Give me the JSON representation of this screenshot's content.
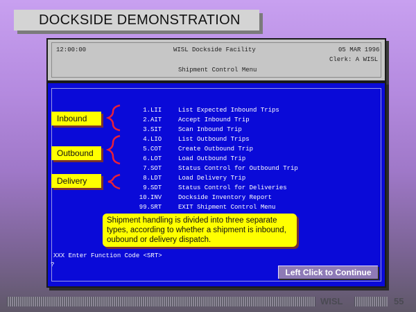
{
  "title": "DOCKSIDE DEMONSTRATION",
  "header": {
    "time": "12:00:00",
    "facility": "WISL Dockside Facility",
    "date": "05 MAR 1996",
    "clerk": "Clerk: A WISL",
    "menu_title": "Shipment Control Menu"
  },
  "menu": [
    {
      "num": "1.",
      "code": "LII",
      "desc": "List Expected Inbound Trips"
    },
    {
      "num": "2.",
      "code": "AIT",
      "desc": "Accept Inbound Trip"
    },
    {
      "num": "3.",
      "code": "SIT",
      "desc": "Scan Inbound Trip"
    },
    {
      "num": "4.",
      "code": "LIO",
      "desc": "List Outbound Trips"
    },
    {
      "num": "5.",
      "code": "COT",
      "desc": "Create Outbound Trip"
    },
    {
      "num": "6.",
      "code": "LOT",
      "desc": "Load Outbound Trip"
    },
    {
      "num": "7.",
      "code": "SOT",
      "desc": "Status Control for Outbound Trip"
    },
    {
      "num": "8.",
      "code": "LDT",
      "desc": "Load Delivery Trip"
    },
    {
      "num": "9.",
      "code": "SDT",
      "desc": "Status Control for Deliveries"
    },
    {
      "num": "10.",
      "code": "INV",
      "desc": "Dockside Inventory Report"
    },
    {
      "num": "99.",
      "code": "SRT",
      "desc": "EXIT Shipment Control Menu"
    }
  ],
  "categories": {
    "inbound": "Inbound",
    "outbound": "Outbound",
    "delivery": "Delivery"
  },
  "note": "Shipment handling is divided into three separate types, according to whether a shipment is inbound, oubound or delivery dispatch.",
  "prompt": "XXX Enter Function Code <SRT>",
  "cursor": "?",
  "continue_label": "Left Click to Continue",
  "footer": {
    "label": "WISL",
    "page": "55"
  },
  "colors": {
    "screen_bg": "#0a0ad8",
    "callout_bg": "#ffff00",
    "brace": "#e8203a"
  }
}
